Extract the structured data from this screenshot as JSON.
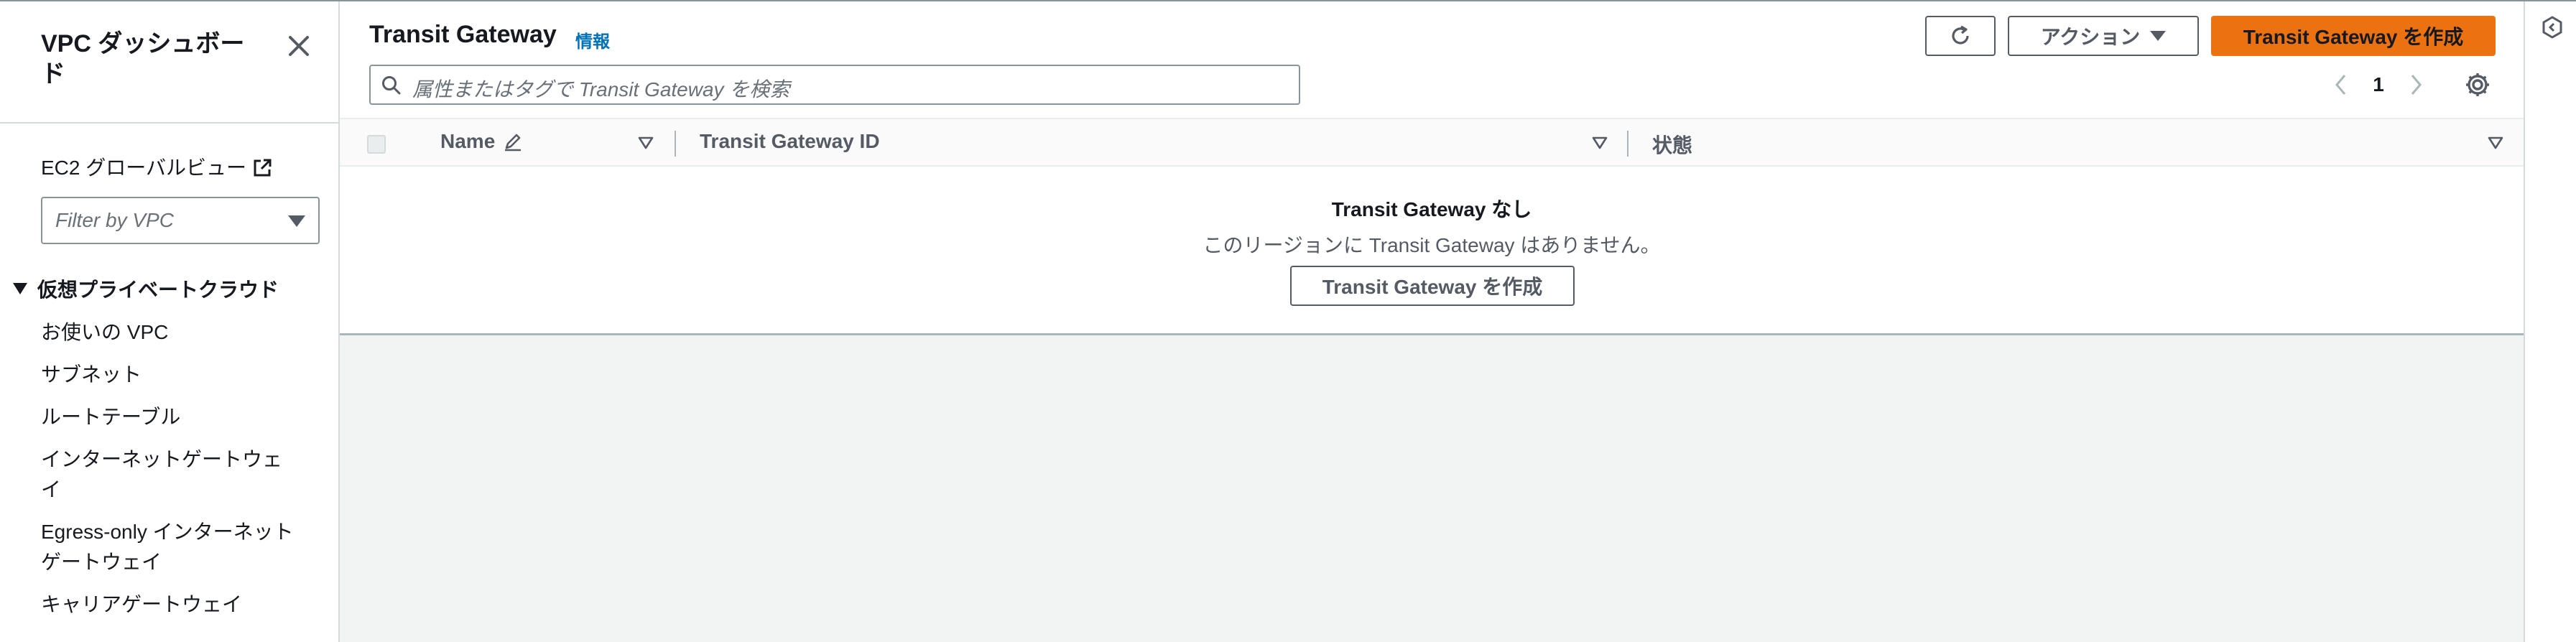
{
  "sidebar": {
    "title": "VPC ダッシュボード",
    "ec2_global_view": "EC2 グローバルビュー",
    "filter_placeholder": "Filter by VPC",
    "section_title": "仮想プライベートクラウド",
    "items": [
      {
        "label": "お使いの VPC"
      },
      {
        "label": "サブネット"
      },
      {
        "label": "ルートテーブル"
      },
      {
        "label": "インターネットゲートウェイ"
      },
      {
        "label": "Egress-only インターネットゲートウェイ"
      },
      {
        "label": "キャリアゲートウェイ"
      }
    ]
  },
  "header": {
    "title": "Transit Gateway",
    "info_link": "情報",
    "actions_label": "アクション",
    "create_label": "Transit Gateway を作成"
  },
  "search": {
    "placeholder": "属性またはタグで Transit Gateway を検索"
  },
  "pagination": {
    "current_page": "1"
  },
  "table": {
    "columns": [
      {
        "label": "Name"
      },
      {
        "label": "Transit Gateway ID"
      },
      {
        "label": "状態"
      }
    ]
  },
  "empty_state": {
    "title": "Transit Gateway なし",
    "description": "このリージョンに Transit Gateway はありません。",
    "button_label": "Transit Gateway を作成"
  },
  "colors": {
    "primary": "#ec7211",
    "link": "#0073bb",
    "page_bg": "#f2f3f3"
  }
}
